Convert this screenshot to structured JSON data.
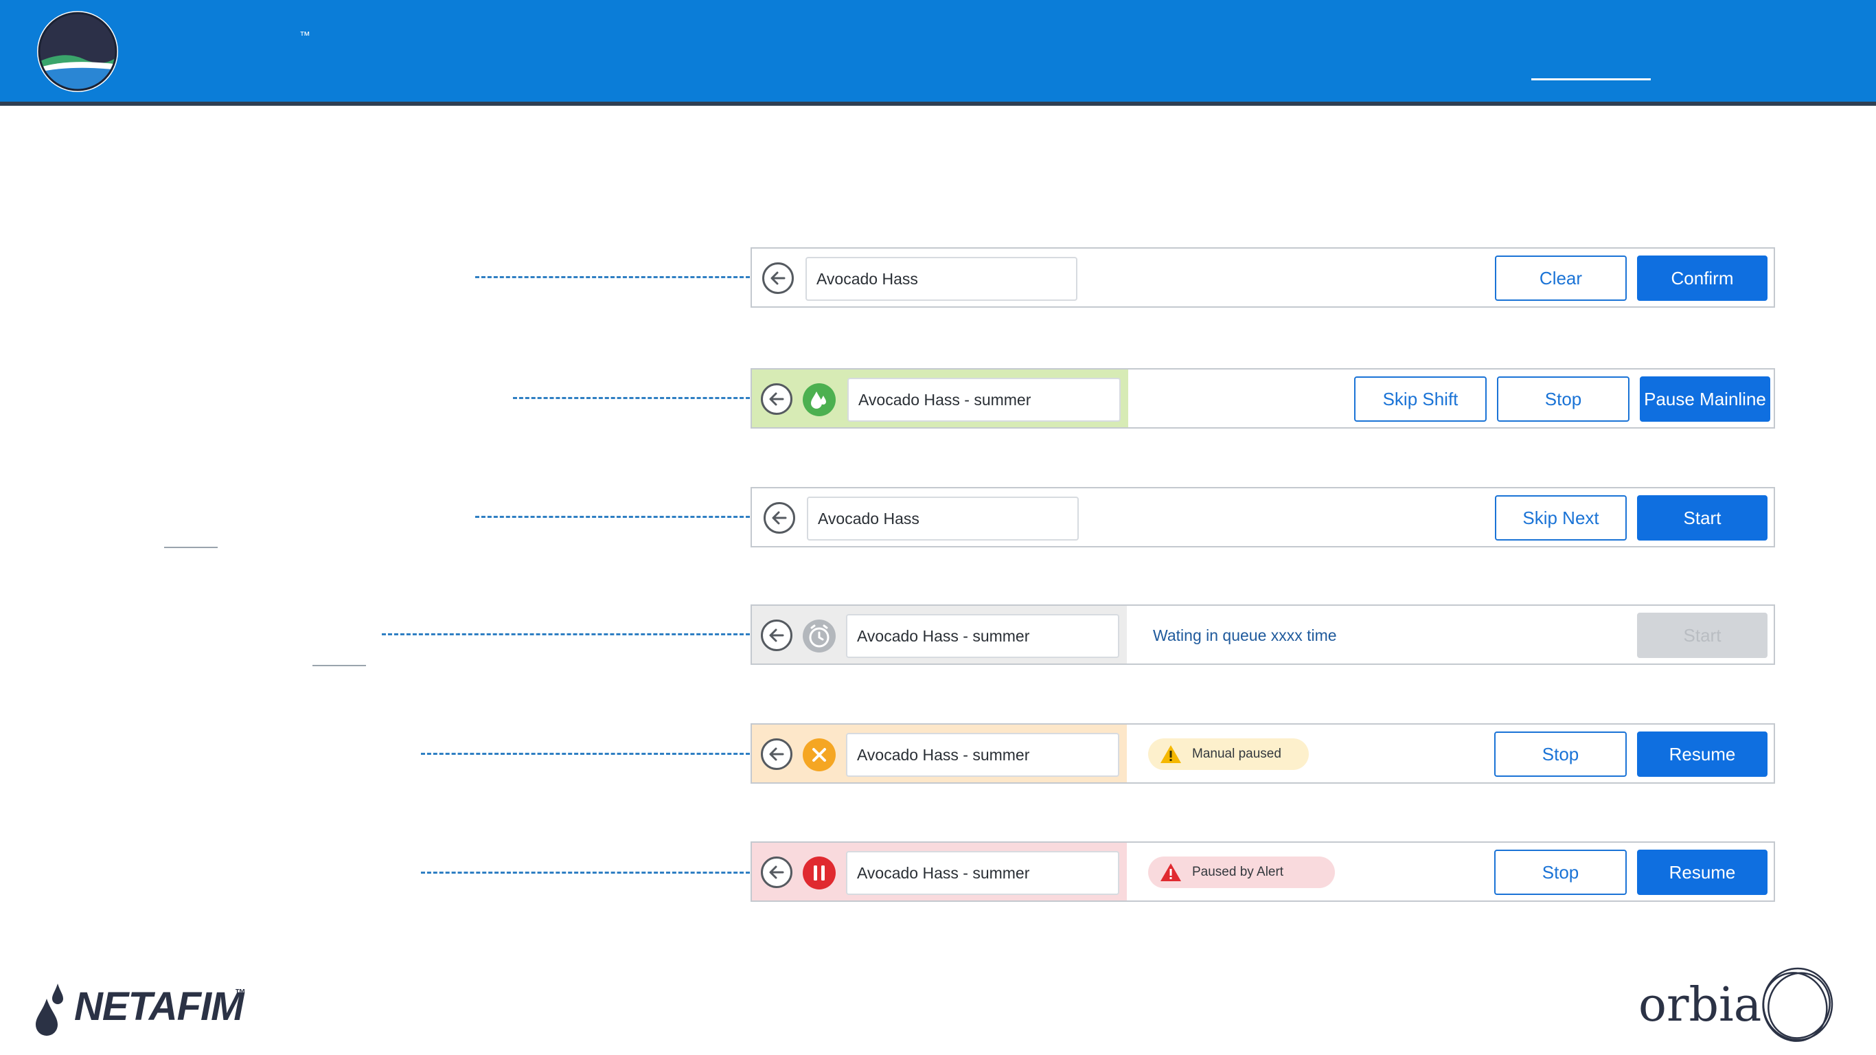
{
  "header": {
    "trademark": "™"
  },
  "rows": [
    {
      "id": "row-1",
      "field_value": "Avocado Hass",
      "buttons": [
        {
          "label": "Clear",
          "style": "outline"
        },
        {
          "label": "Confirm",
          "style": "solid"
        }
      ]
    },
    {
      "id": "row-2",
      "status_icon": "water-drop-icon",
      "status_color": "#4cb050",
      "segment_color": "#d7ebb5",
      "field_value": "Avocado Hass - summer",
      "buttons": [
        {
          "label": "Skip Shift",
          "style": "outline"
        },
        {
          "label": "Stop",
          "style": "outline"
        },
        {
          "label": "Pause Mainline",
          "style": "solid"
        }
      ]
    },
    {
      "id": "row-3",
      "field_value": "Avocado Hass",
      "buttons": [
        {
          "label": "Skip Next",
          "style": "outline"
        },
        {
          "label": "Start",
          "style": "solid"
        }
      ]
    },
    {
      "id": "row-4",
      "status_icon": "clock-icon",
      "status_color": "#b3b7bc",
      "segment_color": "#ececec",
      "field_value": "Avocado Hass - summer",
      "status_text": "Wating in queue xxxx time",
      "buttons": [
        {
          "label": "Start",
          "style": "disabled"
        }
      ]
    },
    {
      "id": "row-5",
      "status_icon": "close-circle-icon",
      "status_color": "#f5a623",
      "segment_color": "#fde7c9",
      "field_value": "Avocado Hass - summer",
      "pill": {
        "label": "Manual paused",
        "icon": "warning-icon",
        "color": "#f5b800",
        "bg": "#fdf0cc"
      },
      "buttons": [
        {
          "label": "Stop",
          "style": "outline"
        },
        {
          "label": "Resume",
          "style": "solid"
        }
      ]
    },
    {
      "id": "row-6",
      "status_icon": "pause-icon",
      "status_color": "#e02a30",
      "segment_color": "#f9dadd",
      "field_value": "Avocado Hass - summer",
      "pill": {
        "label": "Paused by Alert",
        "icon": "warning-icon",
        "color": "#e02a30",
        "bg": "#f9dadd"
      },
      "buttons": [
        {
          "label": "Stop",
          "style": "outline"
        },
        {
          "label": "Resume",
          "style": "solid"
        }
      ]
    }
  ],
  "footer": {
    "left_brand": "NETAFIM",
    "left_brand_tm": "™",
    "right_brand": "orbia"
  },
  "colors": {
    "header_bg": "#0b7dd8",
    "accent": "#0f6fe0",
    "callout": "#2f7fc3"
  }
}
